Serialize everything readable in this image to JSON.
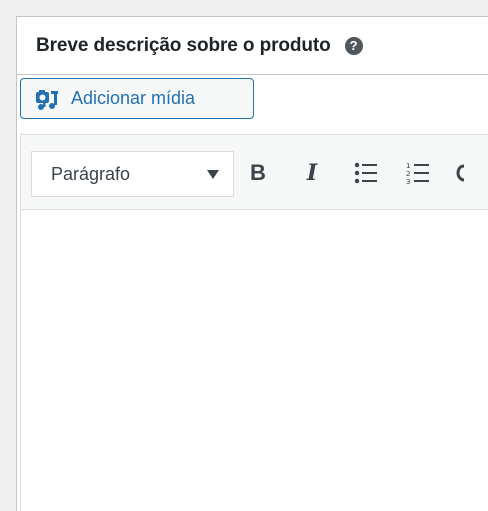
{
  "panel": {
    "title": "Breve descrição sobre o produto",
    "help_glyph": "?"
  },
  "media_button": {
    "label": "Adicionar mídia",
    "icon": "add-media-icon"
  },
  "toolbar": {
    "format_select": {
      "selected": "Parágrafo"
    },
    "bold_label": "B",
    "italic_label": "I",
    "icons": [
      "bullet-list-icon",
      "numbered-list-icon",
      "quote-icon"
    ]
  },
  "colors": {
    "accent": "#2271b1",
    "border": "#c3c4c7",
    "text": "#1d2327",
    "background": "#f0f0f1"
  }
}
